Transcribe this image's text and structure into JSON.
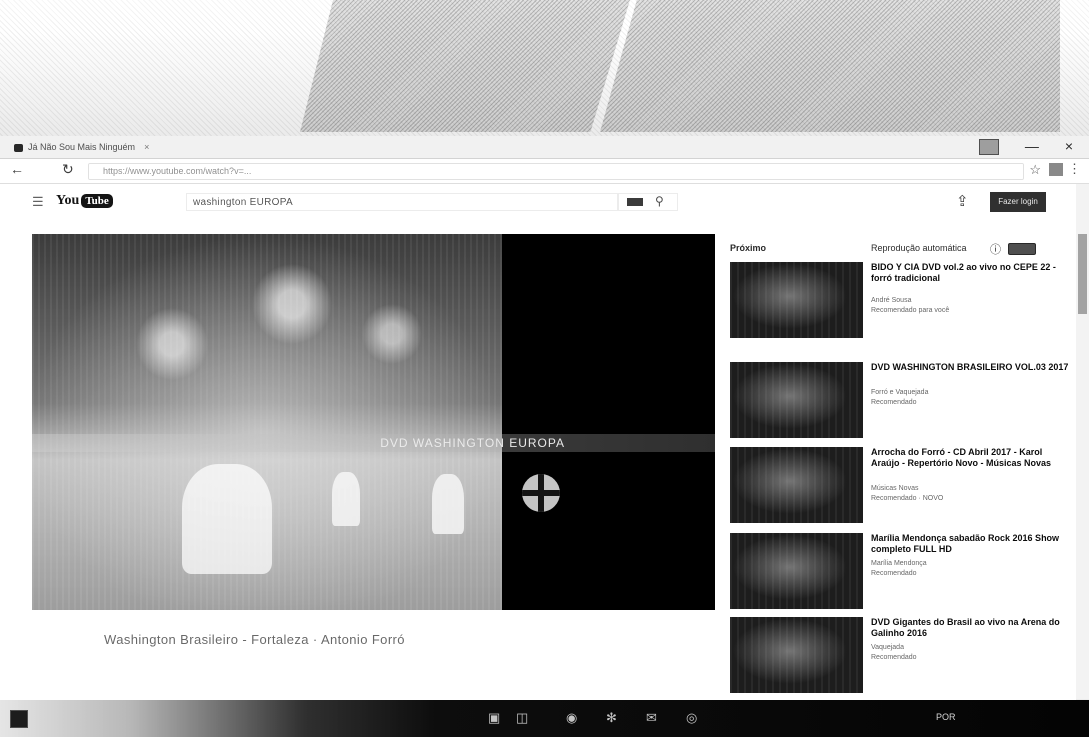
{
  "browser": {
    "tab_title": "Já Não Sou Mais Ninguém",
    "tab_close": "×",
    "address": "https://www.youtube.com/watch?v=...",
    "minimize": "—",
    "close": "×"
  },
  "youtube": {
    "logo_you": "You",
    "logo_tube": "Tube",
    "search_value": "washington EUROPA",
    "signin_label": "Fazer login"
  },
  "player": {
    "banner_text": "DVD WASHINGTON EUROPA"
  },
  "video": {
    "title": "Washington Brasileiro - Fortaleza · Antonio Forró"
  },
  "sidebar": {
    "up_next": "Próximo",
    "autoplay": "Reprodução automática",
    "recommendations": [
      {
        "title": "BIDO Y CIA DVD vol.2 ao vivo no CEPE 22 - forró tradicional",
        "channel": "André Sousa",
        "meta": "Recomendado para você"
      },
      {
        "title": "DVD WASHINGTON BRASILEIRO VOL.03 2017",
        "channel": "Forró e Vaquejada",
        "meta": "Recomendado"
      },
      {
        "title": "Arrocha do Forró - CD Abril 2017 - Karol Araújo - Repertório Novo - Músicas Novas",
        "channel": "Músicas Novas",
        "meta": "Recomendado · NOVO"
      },
      {
        "title": "Marília Mendonça sabadão Rock 2016 Show completo FULL HD",
        "channel": "Marília Mendonça",
        "meta": "Recomendado"
      },
      {
        "title": "DVD Gigantes do Brasil ao vivo na Arena do Galinho 2016",
        "channel": "Vaquejada",
        "meta": "Recomendado"
      }
    ]
  },
  "taskbar": {
    "tray_text": "POR"
  },
  "colors": {
    "signin_button": "#3a3a3a",
    "player_background": "#111111"
  }
}
